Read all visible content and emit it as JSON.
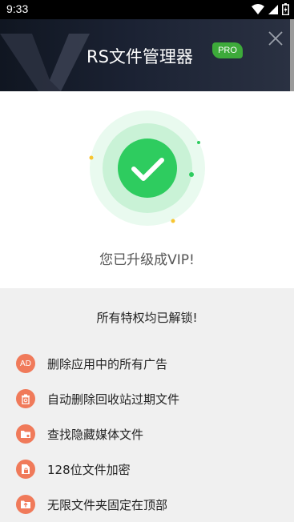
{
  "status_bar": {
    "time": "9:33",
    "icons": [
      "wifi-icon",
      "signal-icon",
      "battery-icon"
    ]
  },
  "header": {
    "title": "RS文件管理器",
    "badge": "PRO",
    "close_icon": "close-icon"
  },
  "success": {
    "message": "您已升级成VIP!",
    "icon": "check-icon",
    "accent_color": "#2ecc5f"
  },
  "features": {
    "title": "所有特权均已解锁!",
    "items": [
      {
        "icon": "ad-icon",
        "icon_text": "AD",
        "label": "删除应用中的所有广告"
      },
      {
        "icon": "recycle-bin-icon",
        "icon_text": "",
        "label": "自动删除回收站过期文件"
      },
      {
        "icon": "hidden-media-icon",
        "icon_text": "",
        "label": "查找隐藏媒体文件"
      },
      {
        "icon": "lock-file-icon",
        "icon_text": "",
        "label": "128位文件加密"
      },
      {
        "icon": "pin-folder-icon",
        "icon_text": "",
        "label": "无限文件夹固定在顶部"
      }
    ],
    "icon_color": "#f07a5a"
  }
}
